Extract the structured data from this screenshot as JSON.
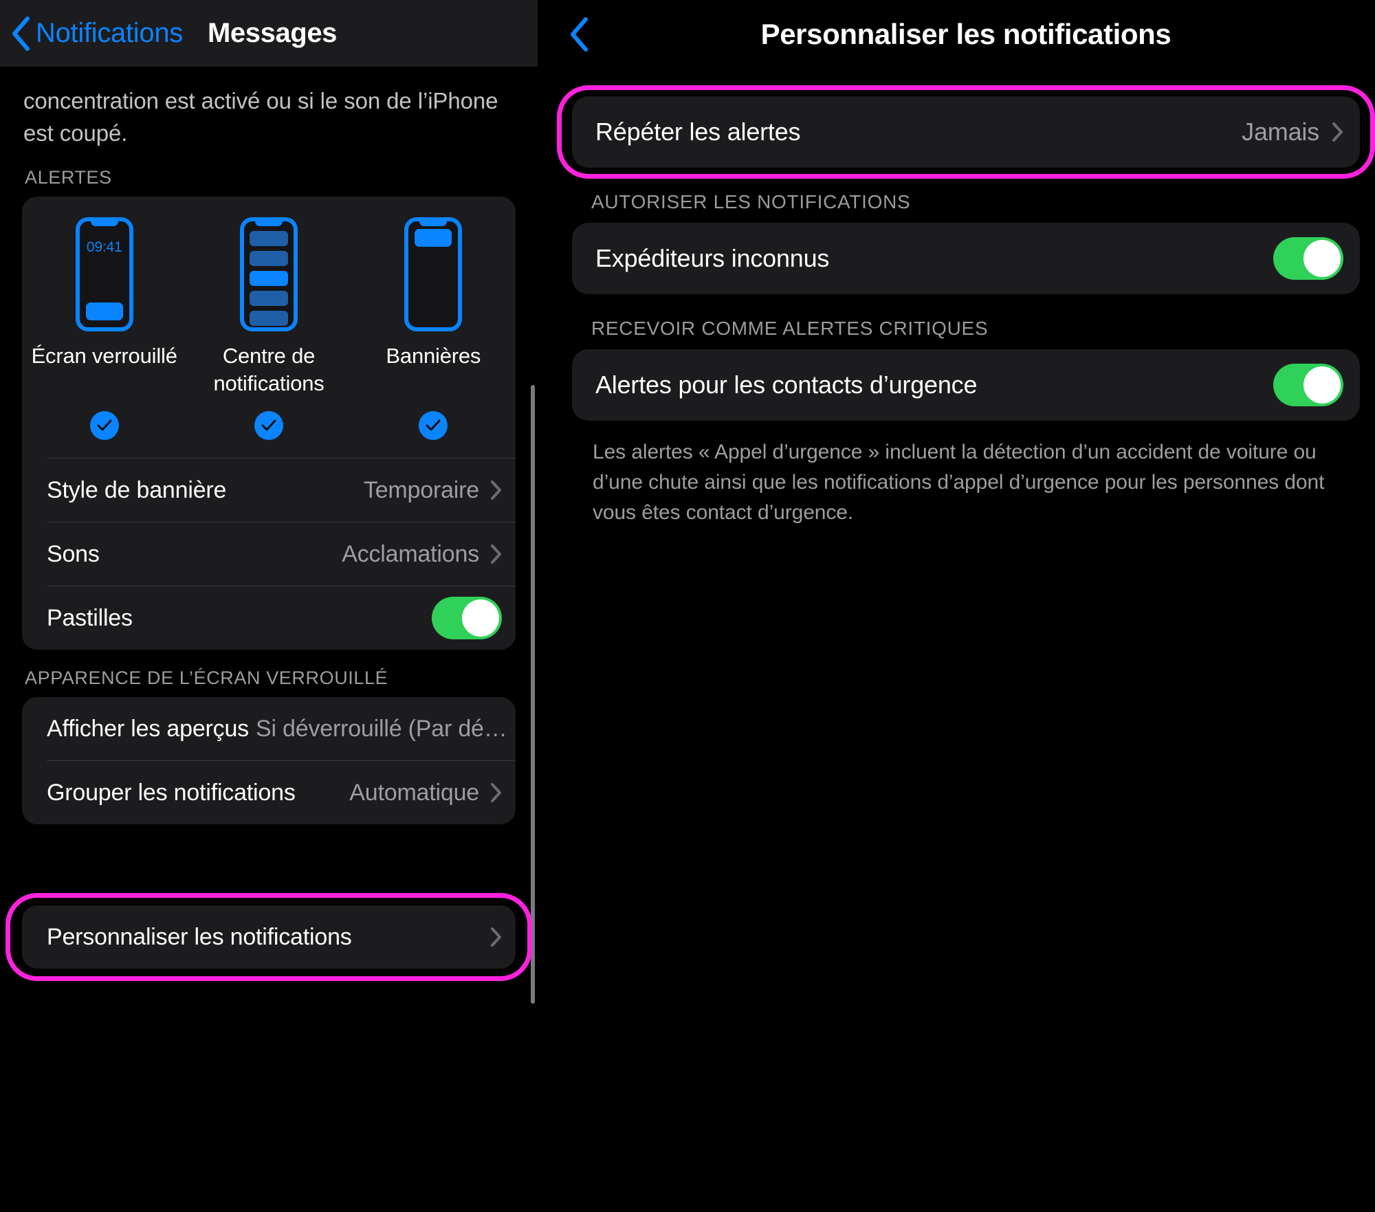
{
  "left": {
    "nav": {
      "back_label": "Notifications",
      "title": "Messages"
    },
    "intro_text": "concentration est activé ou si le son de l’iPhone est coupé.",
    "alerts": {
      "header": "ALERTES",
      "choices": [
        {
          "label": "Écran verrouillé",
          "checked": true,
          "time": "09:41"
        },
        {
          "label": "Centre de notifications",
          "checked": true
        },
        {
          "label": "Bannières",
          "checked": true
        }
      ],
      "rows": [
        {
          "label": "Style de bannière",
          "value": "Temporaire",
          "type": "chevron"
        },
        {
          "label": "Sons",
          "value": "Acclamations",
          "type": "chevron"
        },
        {
          "label": "Pastilles",
          "value": "",
          "type": "toggle",
          "on": true
        }
      ]
    },
    "lock_screen": {
      "header": "APPARENCE DE L’ÉCRAN VERROUILLÉ",
      "rows": [
        {
          "label": "Afficher les aperçus",
          "value": "Si déverrouillé (Par dé…",
          "type": "chevron"
        },
        {
          "label": "Grouper les notifications",
          "value": "Automatique",
          "type": "chevron"
        }
      ]
    },
    "customize_row": {
      "label": "Personnaliser les notifications",
      "type": "chevron"
    }
  },
  "right": {
    "nav": {
      "title": "Personnaliser les notifications"
    },
    "repeat_row": {
      "label": "Répéter les alertes",
      "value": "Jamais",
      "type": "chevron"
    },
    "allow": {
      "header": "AUTORISER LES NOTIFICATIONS",
      "rows": [
        {
          "label": "Expéditeurs inconnus",
          "type": "toggle",
          "on": true
        }
      ]
    },
    "critical": {
      "header": "RECEVOIR COMME ALERTES CRITIQUES",
      "rows": [
        {
          "label": "Alertes pour les contacts d’urgence",
          "type": "toggle",
          "on": true
        }
      ],
      "footnote": "Les alertes « Appel d’urgence » incluent la détection d’un accident de voiture ou d’une chute ainsi que les notifications d’appel d’urgence pour les personnes dont vous êtes contact d’urgence."
    }
  },
  "colors": {
    "accent_blue": "#0a84ff",
    "toggle_green": "#30d158",
    "highlight_magenta": "#ff22dd",
    "card_bg": "#1c1c1e",
    "secondary_text": "#9e9ea2"
  }
}
